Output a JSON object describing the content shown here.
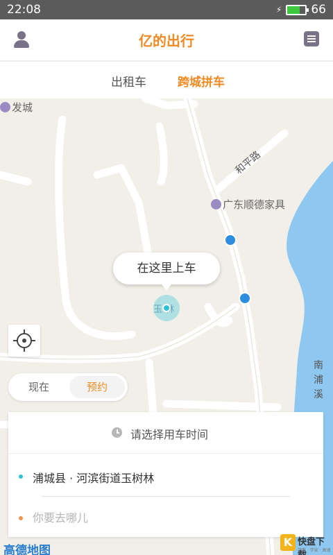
{
  "status_bar": {
    "time": "22:08",
    "battery_level": "66",
    "battery_fraction": 0.66
  },
  "header": {
    "title": "亿的出行"
  },
  "tabs": [
    {
      "label": "出租车",
      "active": false
    },
    {
      "label": "跨城拼车",
      "active": true
    }
  ],
  "map": {
    "labels": {
      "top_left": "发城",
      "poi": "广东顺德家具",
      "road": "和平路",
      "pin_area": "玉 林",
      "river": [
        "南",
        "浦",
        "溪"
      ]
    },
    "pickup_bubble": "在这里上车",
    "logo": "高德地图",
    "watermark": {
      "main": "快盘下载",
      "sub": "学敬 · 学安 · 高速",
      "badge": "K"
    }
  },
  "time_toggle": {
    "now": "现在",
    "reserve": "预约",
    "selected": "预约"
  },
  "booking": {
    "time_prompt": "请选择用车时间",
    "from": "浦城县 · 河滨街道玉树林",
    "to_placeholder": "你要去哪儿"
  },
  "colors": {
    "accent": "#f08a24",
    "pin": "#2fc1d6",
    "destination_dot": "#f0954e",
    "river": "#8ec8f0",
    "status_bar": "#5b5b5b"
  }
}
